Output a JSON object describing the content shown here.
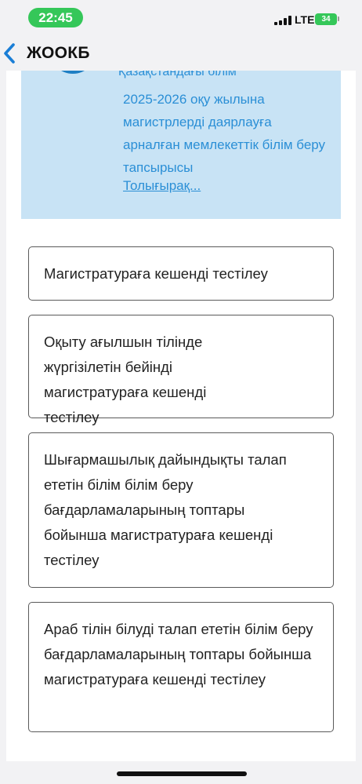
{
  "status_bar": {
    "time": "22:45",
    "network": "LTE",
    "battery": "34",
    "accent_color": "#35c759"
  },
  "header": {
    "back_icon": "chevron-left-icon",
    "title": "ЖООКБ"
  },
  "info_card": {
    "cut_off_line": "Қазақстандағы білім",
    "text": "2025-2026 оқу жылына магистрлерді даярлауға арналған мемлекеттік білім беру тапсырысы",
    "link": "Толығырақ..."
  },
  "options": [
    {
      "label": "Магистратураға кешенді тестілеу"
    },
    {
      "label": "Оқыту ағылшын тілінде жүргізілетін бейінді магистратураға кешенді тестілеу"
    },
    {
      "label": "Шығармашылық дайындықты талап ететін білім білім беру бағдарламаларының топтары бойынша магистратураға кешенді тестілеу"
    },
    {
      "label": "Араб тілін білуді талап ететін білім беру бағдарламаларының топтары бойынша магистратураға кешенді тестілеу"
    }
  ]
}
